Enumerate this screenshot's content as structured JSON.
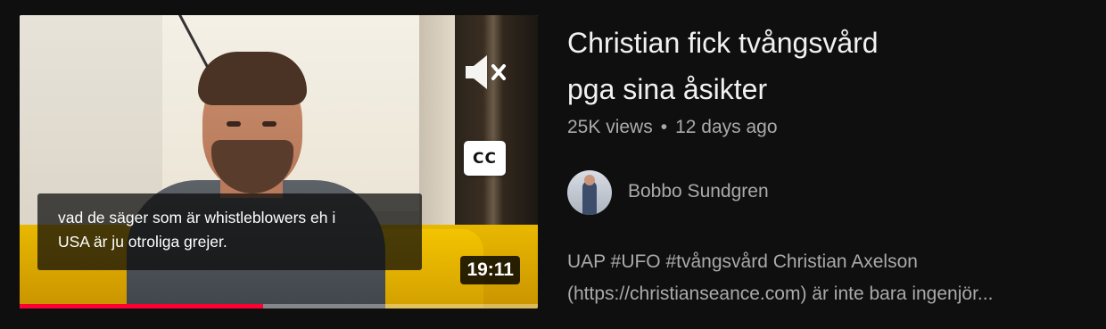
{
  "video": {
    "caption_text": "vad de säger som är whistleblowers eh i\nUSA är ju otroliga grejer.",
    "cc_label": "CC",
    "duration": "19:11",
    "progress_fraction": 0.47,
    "mute_icon": "volume-muted-icon",
    "colors": {
      "progress": "#ff0033",
      "background": "#0f0f0f"
    }
  },
  "info": {
    "title": "Christian fick tvångsvård\npga sina åsikter",
    "views": "25K views",
    "separator": "•",
    "age": "12 days ago",
    "channel_name": "Bobbo Sundgren",
    "description_line1": "UAP #UFO #tvångsvård Christian Axelson",
    "description_line2": "(https://christianseance.com) är inte bara ingenjör..."
  }
}
